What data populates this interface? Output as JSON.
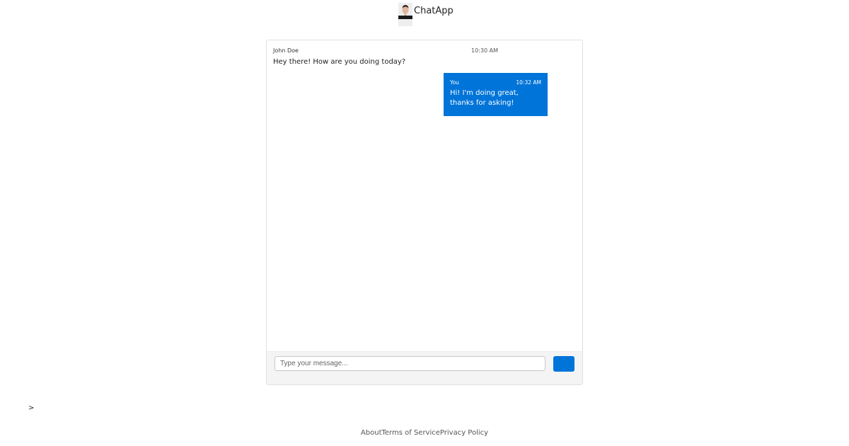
{
  "header": {
    "app_title": "ChatApp",
    "avatar_icon": "user-avatar"
  },
  "chat": {
    "messages": [
      {
        "sender": "John Doe",
        "time": "10:30 AM",
        "text": "Hey there! How are you doing today?",
        "direction": "incoming"
      },
      {
        "sender": "You",
        "time": "10:32 AM",
        "text": "Hi! I'm doing great, thanks for asking!",
        "direction": "outgoing"
      }
    ],
    "input": {
      "value": "",
      "placeholder": "Type your message..."
    },
    "send_button": {
      "label": "",
      "icon": "send-icon"
    }
  },
  "stray_text": ">",
  "footer": {
    "links": [
      "About",
      "Terms of Service",
      "Privacy Policy"
    ]
  },
  "colors": {
    "accent": "#0074d9",
    "card_border": "#e0e0e0",
    "input_bar_bg": "#f4f4f4"
  }
}
